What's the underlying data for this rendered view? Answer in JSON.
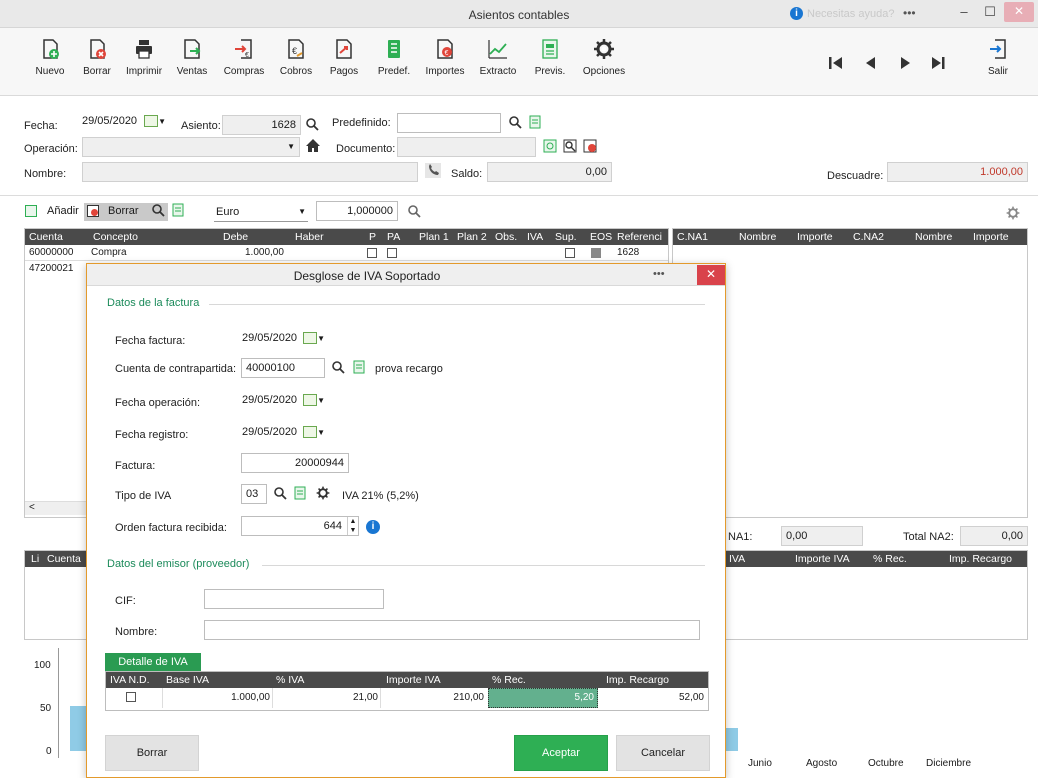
{
  "window": {
    "title": "Asientos contables",
    "help_text": "Necesitas ayuda?",
    "more": "•••",
    "minimize": "–",
    "maximize": "☐",
    "close": "✕"
  },
  "toolbar": {
    "buttons": [
      {
        "label": "Nuevo",
        "icon": "new-doc-icon"
      },
      {
        "label": "Borrar",
        "icon": "delete-doc-icon"
      },
      {
        "label": "Imprimir",
        "icon": "printer-icon"
      },
      {
        "label": "Ventas",
        "icon": "sales-icon"
      },
      {
        "label": "Compras",
        "icon": "purchases-icon"
      },
      {
        "label": "Cobros",
        "icon": "collections-icon"
      },
      {
        "label": "Pagos",
        "icon": "payments-icon"
      },
      {
        "label": "Predef.",
        "icon": "predefined-icon"
      },
      {
        "label": "Importes",
        "icon": "amounts-icon"
      },
      {
        "label": "Extracto",
        "icon": "statement-icon"
      },
      {
        "label": "Previs.",
        "icon": "forecast-icon"
      },
      {
        "label": "Opciones",
        "icon": "gear-icon"
      }
    ],
    "exit_label": "Salir"
  },
  "form": {
    "fecha_label": "Fecha:",
    "fecha_value": "29/05/2020",
    "asiento_label": "Asiento:",
    "asiento_value": "1628",
    "predefinido_label": "Predefinido:",
    "operacion_label": "Operación:",
    "documento_label": "Documento:",
    "nombre_label": "Nombre:",
    "saldo_label": "Saldo:",
    "saldo_value": "0,00",
    "descuadre_label": "Descuadre:",
    "descuadre_value": "1.000,00"
  },
  "grid_toolbar": {
    "add_label": "Añadir",
    "delete_label": "Borrar",
    "currency": "Euro",
    "rate": "1,000000"
  },
  "grid": {
    "columns": [
      "Cuenta",
      "Concepto",
      "Debe",
      "Haber",
      "P",
      "PA",
      "Plan 1",
      "Plan 2",
      "Obs.",
      "IVA",
      "Sup.",
      "EOS",
      "Referenci"
    ],
    "rows": [
      {
        "cuenta": "60000000",
        "concepto": "Compra",
        "debe": "1.000,00",
        "ref": "1628"
      },
      {
        "cuenta": "47200021",
        "concepto": "",
        "debe": "",
        "ref": ""
      }
    ],
    "right_columns": [
      "C.NA1",
      "Nombre",
      "Importe",
      "C.NA2",
      "Nombre",
      "Importe"
    ],
    "na1_label": "NA1:",
    "na1_value": "0,00",
    "na2_label": "Total NA2:",
    "na2_value": "0,00",
    "bottom_columns": [
      "Li",
      "Cuenta",
      "IVA",
      "Importe IVA",
      "% Rec.",
      "Imp. Recargo"
    ]
  },
  "chart": {
    "y_ticks": [
      "100",
      "50",
      "0"
    ],
    "x_ticks": [
      "Junio",
      "Agosto",
      "Octubre",
      "Diciembre"
    ]
  },
  "dialog": {
    "title": "Desglose de IVA Soportado",
    "more": "•••",
    "close": "✕",
    "section_invoice": "Datos de la factura",
    "fecha_factura_label": "Fecha factura:",
    "fecha_factura_value": "29/05/2020",
    "contrapartida_label": "Cuenta de contrapartida:",
    "contrapartida_value": "40000100",
    "contrapartida_name": "prova recargo",
    "fecha_operacion_label": "Fecha operación:",
    "fecha_operacion_value": "29/05/2020",
    "fecha_registro_label": "Fecha registro:",
    "fecha_registro_value": "29/05/2020",
    "factura_label": "Factura:",
    "factura_value": "20000944",
    "tipo_iva_label": "Tipo de IVA",
    "tipo_iva_code": "03",
    "tipo_iva_desc": "IVA 21% (5,2%)",
    "orden_label": "Orden factura recibida:",
    "orden_value": "644",
    "section_emitter": "Datos del emisor (proveedor)",
    "cif_label": "CIF:",
    "nombre_label": "Nombre:",
    "detail_tab": "Detalle de IVA",
    "detail_columns": [
      "IVA N.D.",
      "Base IVA",
      "% IVA",
      "Importe IVA",
      "% Rec.",
      "Imp. Recargo"
    ],
    "detail_row": {
      "base": "1.000,00",
      "pct_iva": "21,00",
      "importe_iva": "210,00",
      "pct_rec": "5,20",
      "recargo": "52,00"
    },
    "btn_delete": "Borrar",
    "btn_accept": "Aceptar",
    "btn_cancel": "Cancelar"
  }
}
